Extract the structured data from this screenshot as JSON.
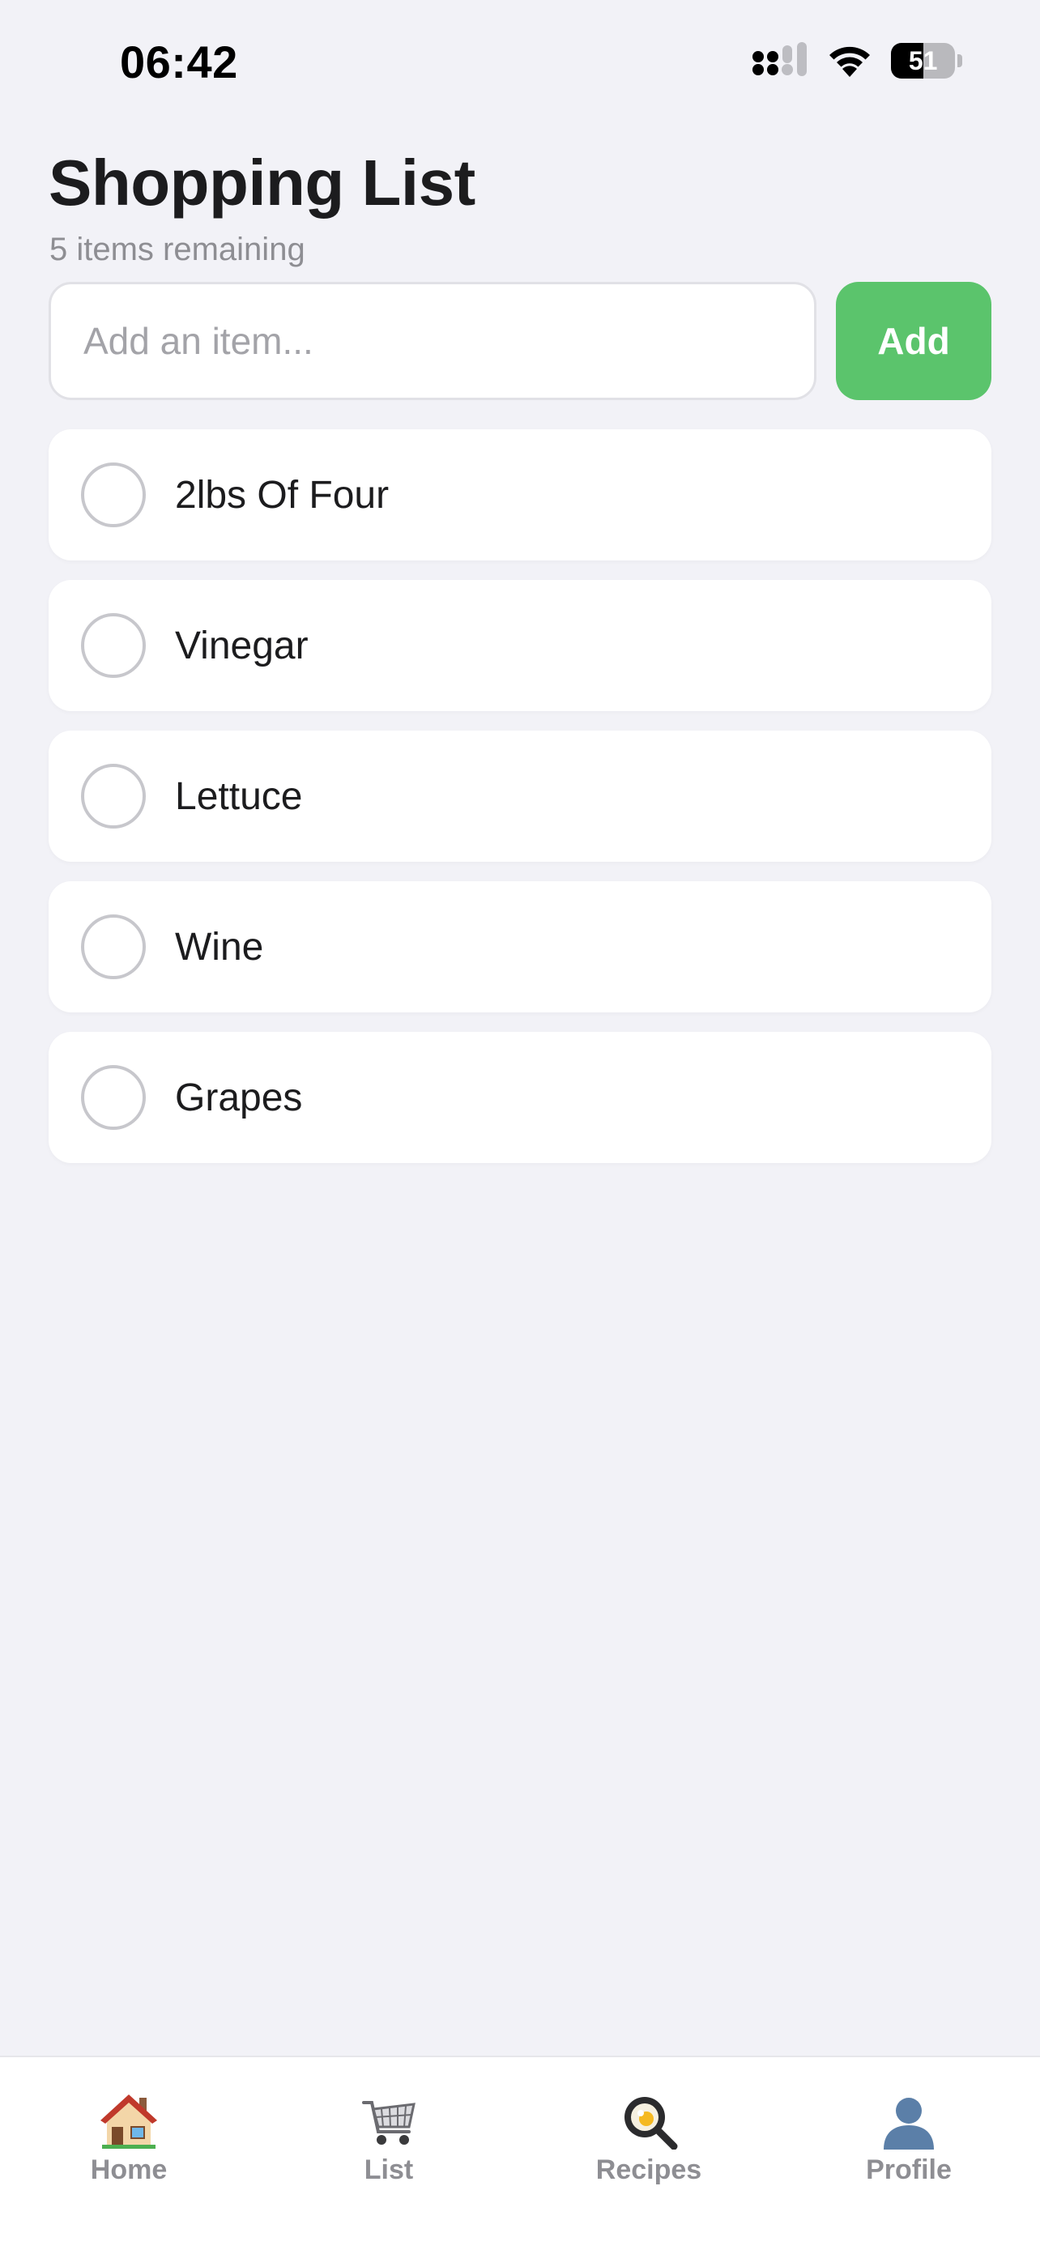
{
  "status_bar": {
    "time": "06:42",
    "battery_percent": "51",
    "battery_level": 0.51
  },
  "header": {
    "title": "Shopping List",
    "subtitle": "5 items remaining"
  },
  "add_row": {
    "placeholder": "Add an item...",
    "value": "",
    "button_label": "Add",
    "button_color": "#5bc46c"
  },
  "items": [
    {
      "label": "2lbs Of Four",
      "checked": false
    },
    {
      "label": "Vinegar",
      "checked": false
    },
    {
      "label": "Lettuce",
      "checked": false
    },
    {
      "label": "Wine",
      "checked": false
    },
    {
      "label": "Grapes",
      "checked": false
    }
  ],
  "tab_bar": {
    "tabs": [
      {
        "label": "Home",
        "icon": "house-icon"
      },
      {
        "label": "List",
        "icon": "shopping-cart-icon"
      },
      {
        "label": "Recipes",
        "icon": "magnifier-icon"
      },
      {
        "label": "Profile",
        "icon": "person-icon"
      }
    ]
  },
  "colors": {
    "background": "#f2f2f7",
    "accent": "#5bc46c",
    "secondary_text": "#8e8e93"
  }
}
